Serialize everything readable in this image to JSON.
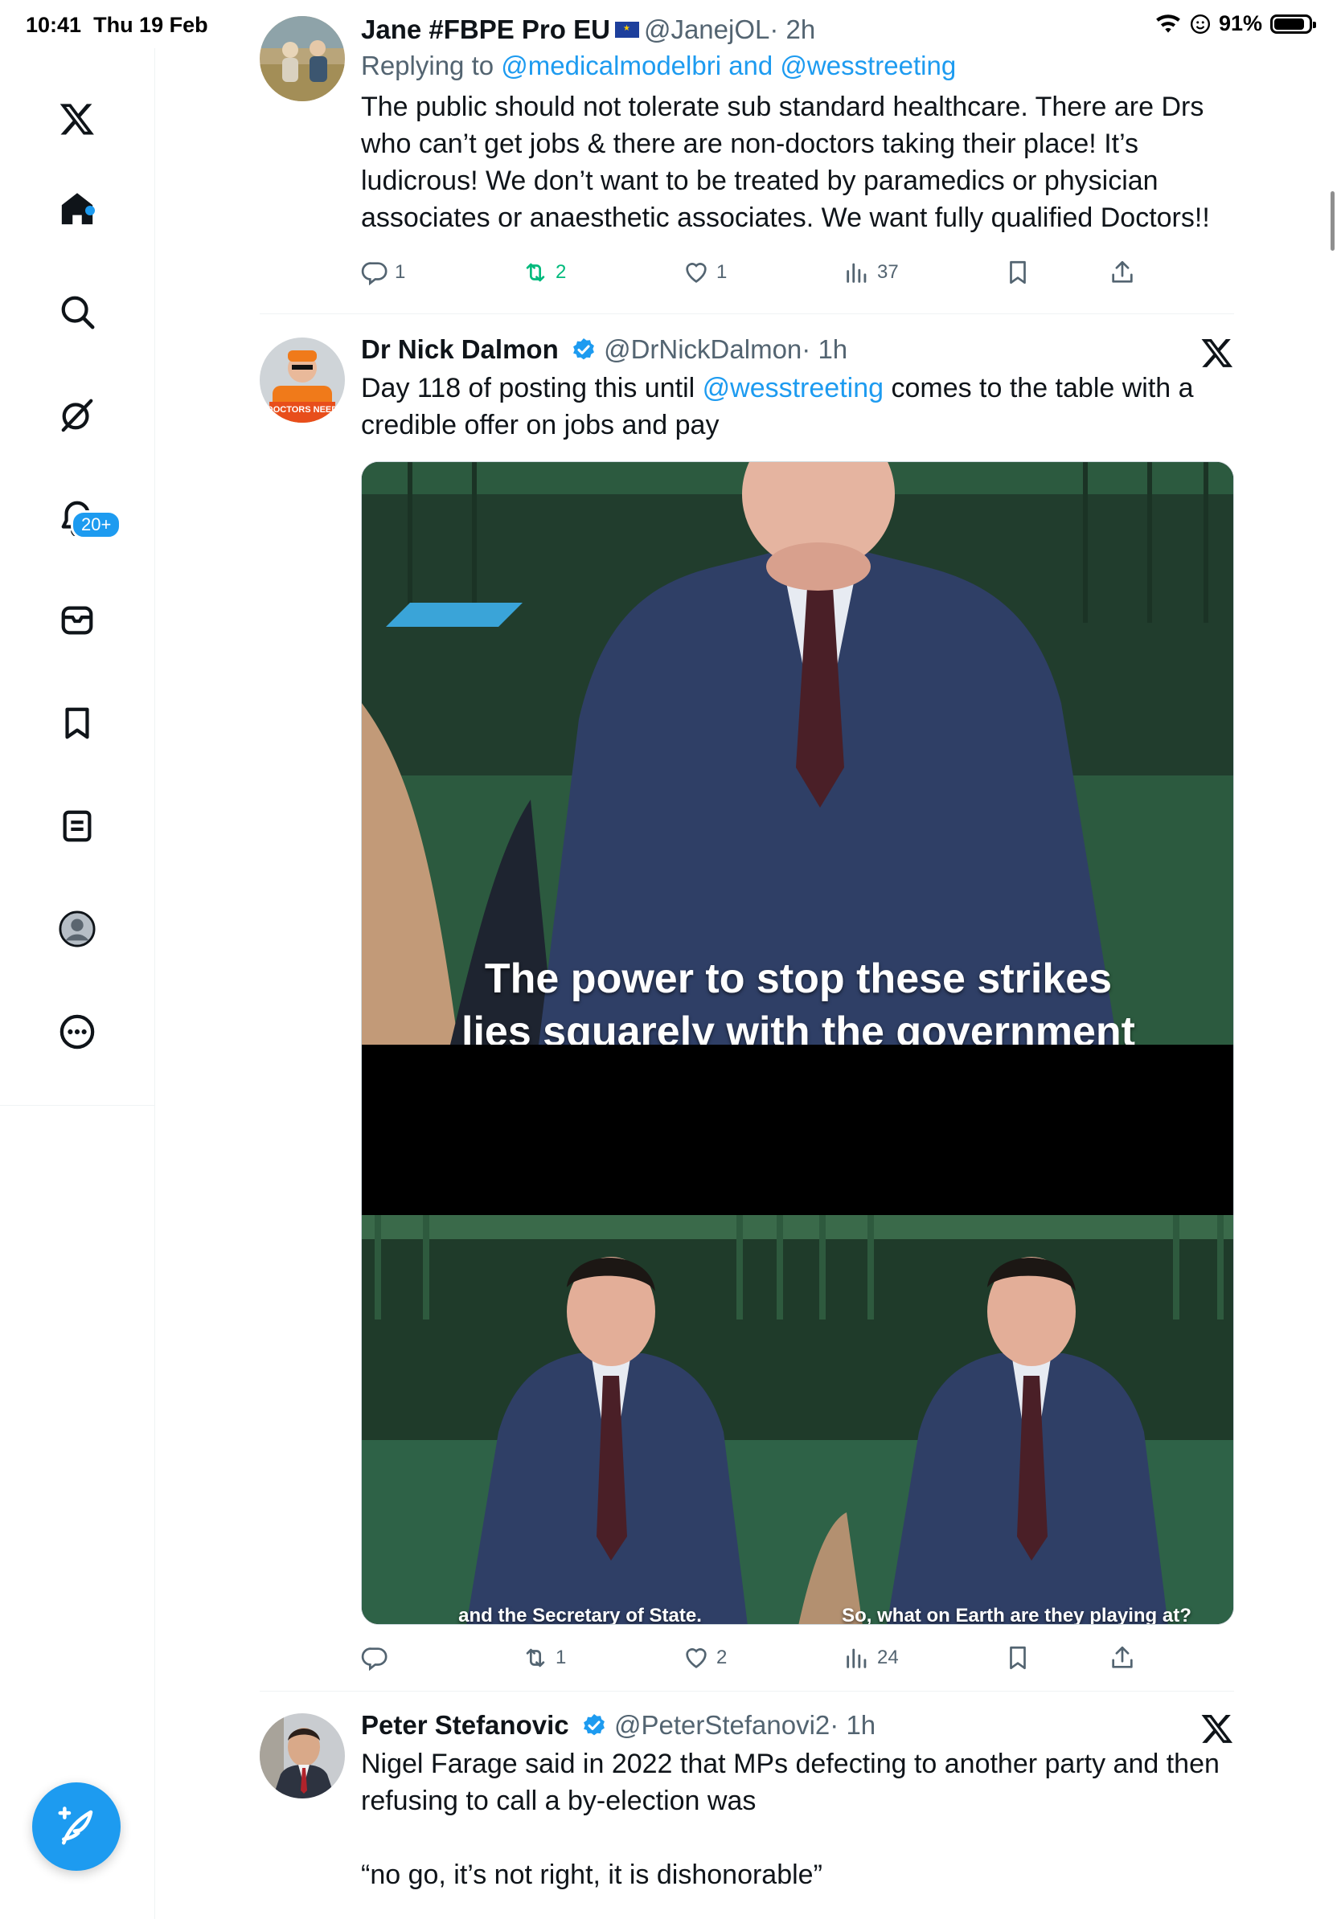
{
  "status": {
    "time": "10:41",
    "date": "Thu 19 Feb",
    "battery": "91%"
  },
  "sidebar": {
    "items": [
      {
        "name": "x-logo"
      },
      {
        "name": "home"
      },
      {
        "name": "search"
      },
      {
        "name": "grok"
      },
      {
        "name": "notifications"
      },
      {
        "name": "messages"
      },
      {
        "name": "bookmarks"
      },
      {
        "name": "lists"
      },
      {
        "name": "profile"
      },
      {
        "name": "more"
      }
    ],
    "notifications_badge": "20+"
  },
  "tweets": [
    {
      "name": "Jane #FBPE Pro EU",
      "handle": "@JanejOL",
      "time": "· 2h",
      "reply_prefix": "Replying to ",
      "reply_users": "@medicalmodelbri and @wesstreeting",
      "text": "The public should not tolerate sub standard healthcare. There are Drs who can’t get jobs & there are non-doctors taking their place! It’s ludicrous! We don’t want to be treated by paramedics or physician associates or anaesthetic associates. We want fully qualified Doctors!!",
      "replies": "1",
      "reposts": "2",
      "likes": "1",
      "views": "37"
    },
    {
      "name": "Dr Nick Dalmon",
      "handle": "@DrNickDalmon",
      "time": "· 1h",
      "text_before": "Day 118 of posting this until ",
      "mention": "@wesstreeting",
      "text_after": " comes to the table with a credible offer on jobs and pay",
      "avatar_sign": "DOCTORS NEED",
      "media": {
        "caption_top_line1": "The power to stop these strikes",
        "caption_top_line2": "lies squarely with the government",
        "caption_left": "and the Secretary of State.",
        "caption_right": "So, what on Earth are they playing at?"
      },
      "replies": "",
      "reposts": "1",
      "likes": "2",
      "views": "24"
    },
    {
      "name": "Peter Stefanovic",
      "handle": "@PeterStefanovi2",
      "time": "· 1h",
      "text_line1": "Nigel Farage said in 2022 that MPs defecting to another party and then refusing to call a by-election was",
      "text_line2": "“no go, it’s not right, it is dishonorable”"
    }
  ]
}
